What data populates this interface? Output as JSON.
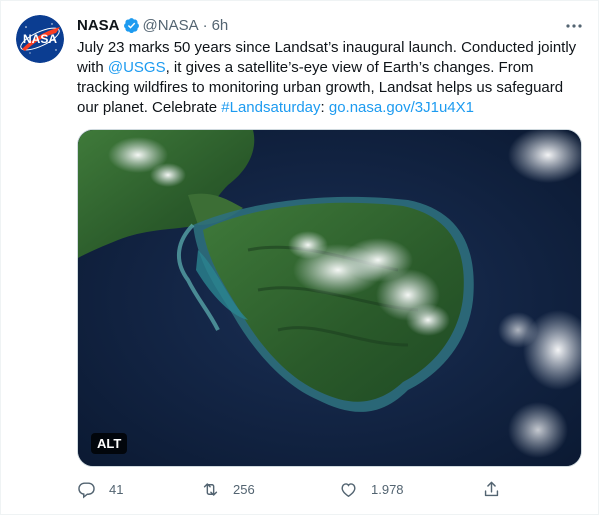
{
  "tweet": {
    "author_name": "NASA",
    "handle": "@NASA",
    "separator": "·",
    "time": "6h",
    "avatar_text": "NASA",
    "text_parts": [
      {
        "text": "July 23 marks 50 years since Landsat’s inaugural launch. Conducted jointly with ",
        "link": false
      },
      {
        "text": "@USGS",
        "link": true
      },
      {
        "text": ", it gives a satellite’s-eye view of Earth’s changes. From tracking wildfires to monitoring urban growth, Landsat helps us safeguard our planet. Celebrate ",
        "link": false
      },
      {
        "text": "#Landsaturday",
        "link": true
      },
      {
        "text": ": ",
        "link": false
      },
      {
        "text": "go.nasa.gov/3J1u4X1",
        "link": true
      }
    ],
    "media": {
      "alt_badge": "ALT",
      "image_description_icon": "satellite-image-of-island"
    },
    "actions": {
      "replies": "41",
      "retweets": "256",
      "likes": "1.978"
    },
    "icons": {
      "verified": "verified-badge-icon",
      "more": "more-icon",
      "reply": "reply-icon",
      "retweet": "retweet-icon",
      "like": "heart-icon",
      "share": "share-icon"
    },
    "colors": {
      "link": "#1d9bf0",
      "secondary_text": "#536471",
      "nasa_blue": "#0b3d91",
      "nasa_red": "#fc3d21"
    }
  }
}
